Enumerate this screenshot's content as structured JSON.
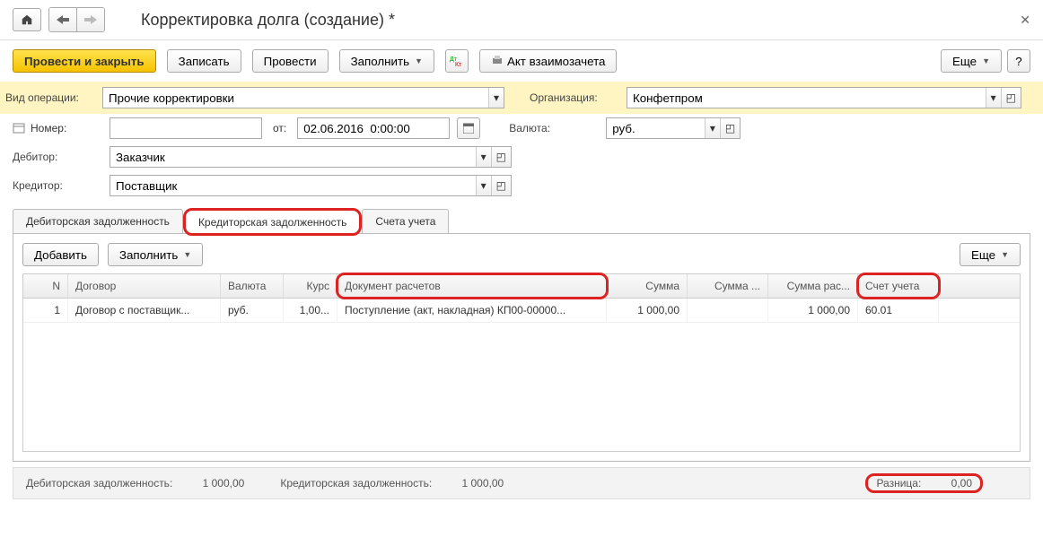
{
  "title": "Корректировка долга (создание) *",
  "toolbar": {
    "save_close": "Провести и закрыть",
    "write": "Записать",
    "post": "Провести",
    "fill": "Заполнить",
    "offset_act": "Акт взаимозачета",
    "more": "Еще"
  },
  "form": {
    "operation_label": "Вид операции:",
    "operation_value": "Прочие корректировки",
    "org_label": "Организация:",
    "org_value": "Конфетпром",
    "number_label": "Номер:",
    "number_value": "",
    "from_label": "от:",
    "date_value": "02.06.2016  0:00:00",
    "currency_label": "Валюта:",
    "currency_value": "руб.",
    "debtor_label": "Дебитор:",
    "debtor_value": "Заказчик",
    "creditor_label": "Кредитор:",
    "creditor_value": "Поставщик"
  },
  "tabs": {
    "debit": "Дебиторская задолженность",
    "credit": "Кредиторская задолженность",
    "accounts": "Счета учета"
  },
  "tab_toolbar": {
    "add": "Добавить",
    "fill": "Заполнить",
    "more": "Еще"
  },
  "table": {
    "headers": {
      "n": "N",
      "contract": "Договор",
      "currency": "Валюта",
      "rate": "Курс",
      "doc": "Документ расчетов",
      "sum": "Сумма",
      "sum2": "Сумма ...",
      "sum3": "Сумма рас...",
      "account": "Счет учета"
    },
    "rows": [
      {
        "n": "1",
        "contract": "Договор с поставщик...",
        "currency": "руб.",
        "rate": "1,00...",
        "doc": "Поступление (акт, накладная) КП00-00000...",
        "sum": "1 000,00",
        "sum2": "",
        "sum3": "1 000,00",
        "account": "60.01"
      }
    ]
  },
  "footer": {
    "debit_label": "Дебиторская задолженность:",
    "debit_value": "1 000,00",
    "credit_label": "Кредиторская задолженность:",
    "credit_value": "1 000,00",
    "diff_label": "Разница:",
    "diff_value": "0,00"
  }
}
